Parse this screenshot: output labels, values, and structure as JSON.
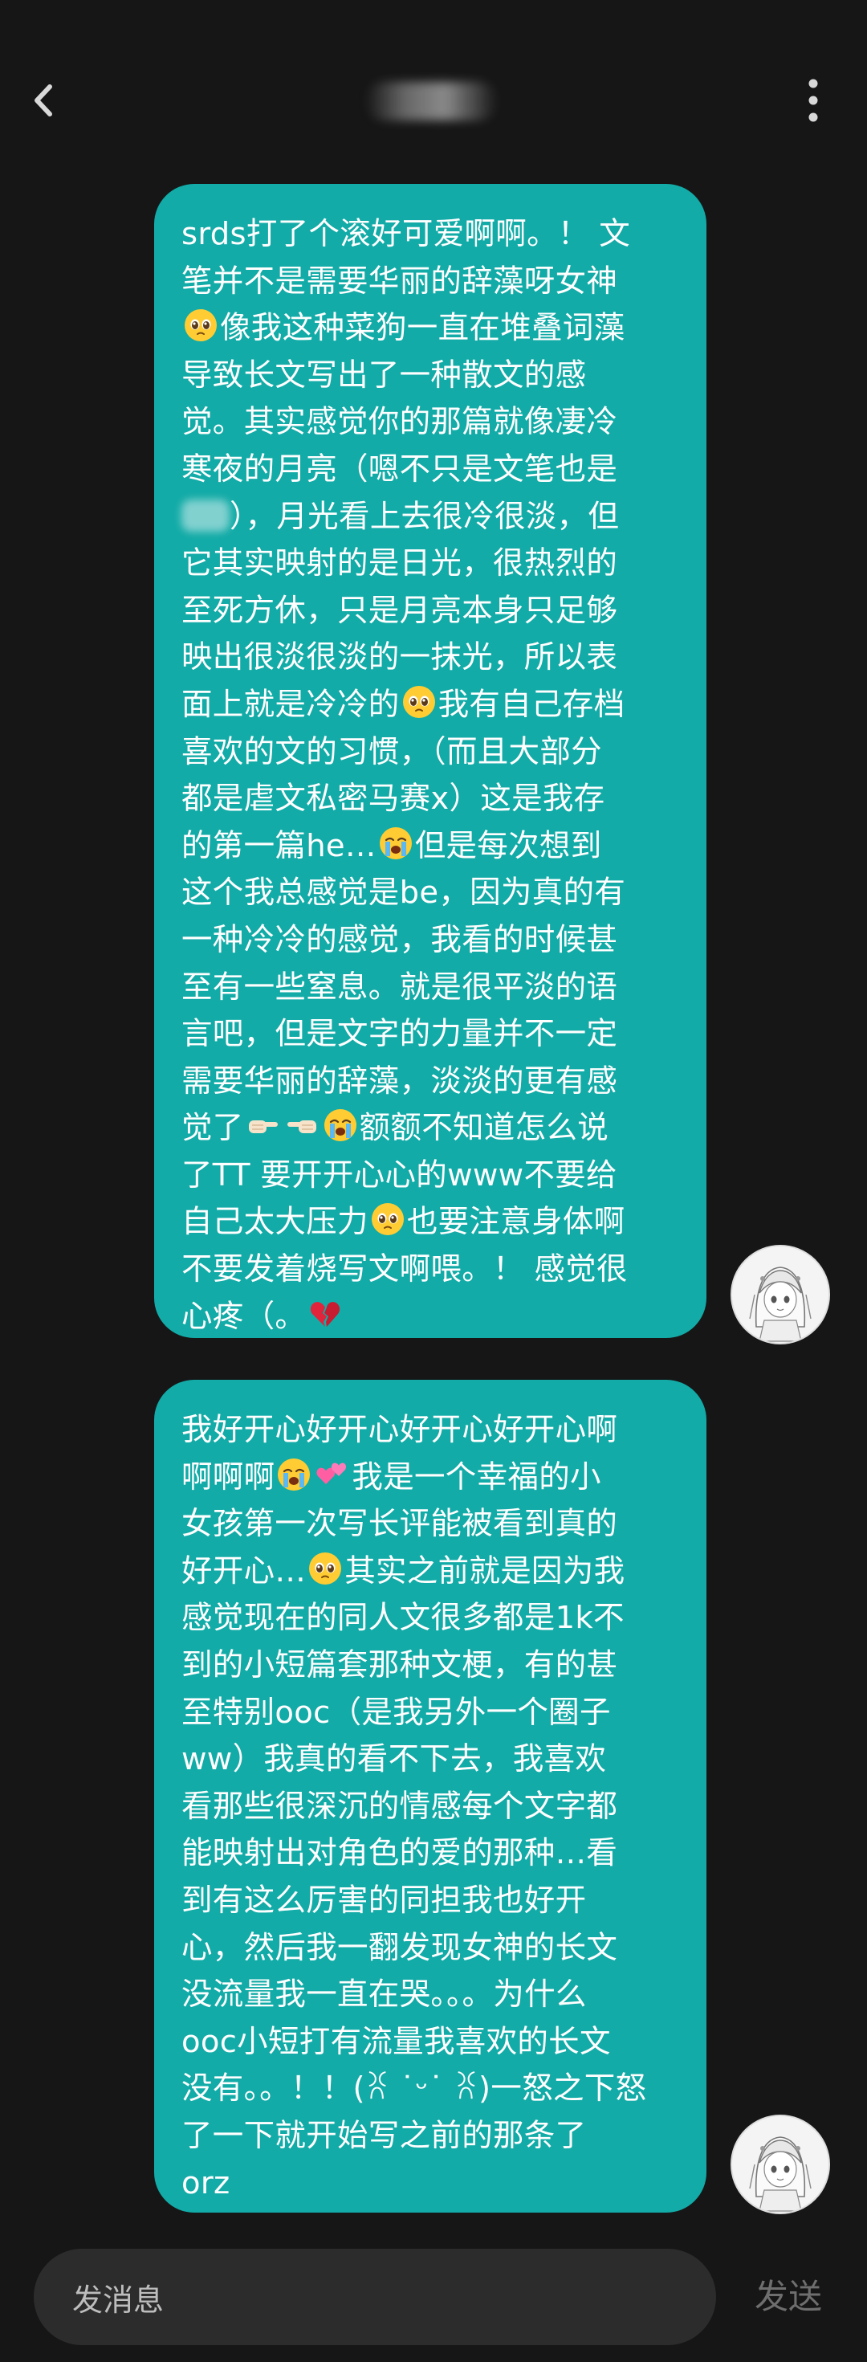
{
  "header": {
    "title": "",
    "back_icon": "chevron-left-icon",
    "more_icon": "more-vertical-icon"
  },
  "messages": [
    {
      "lines": [
        [
          {
            "t": "srds打了个滚好可爱啊啊。！  文"
          }
        ],
        [
          {
            "t": "笔并不是需要华丽的辞藻呀女神"
          }
        ],
        [
          {
            "e": "pleading-face-emoji"
          },
          {
            "t": "像我这种菜狗一直在堆叠词藻"
          }
        ],
        [
          {
            "t": "导致长文写出了一种散文的感"
          }
        ],
        [
          {
            "t": "觉。其实感觉你的那篇就像凄冷"
          }
        ],
        [
          {
            "t": "寒夜的月亮（嗯不只是文笔也是"
          }
        ],
        [
          {
            "b": "blurred-word"
          },
          {
            "t": "），月光看上去很冷很淡，但"
          }
        ],
        [
          {
            "t": "它其实映射的是日光，很热烈的"
          }
        ],
        [
          {
            "t": "至死方休，只是月亮本身只足够"
          }
        ],
        [
          {
            "t": "映出很淡很淡的一抹光，所以表"
          }
        ],
        [
          {
            "t": "面上就是冷冷的"
          },
          {
            "e": "pleading-face-emoji"
          },
          {
            "t": "我有自己存档"
          }
        ],
        [
          {
            "t": "喜欢的文的习惯，（而且大部分"
          }
        ],
        [
          {
            "t": "都是虐文私密马赛x）这是我存"
          }
        ],
        [
          {
            "t": "的第一篇he…"
          },
          {
            "e": "crying-face-emoji"
          },
          {
            "t": "但是每次想到"
          }
        ],
        [
          {
            "t": "这个我总感觉是be，因为真的有"
          }
        ],
        [
          {
            "t": "一种冷冷的感觉，我看的时候甚"
          }
        ],
        [
          {
            "t": "至有一些窒息。就是很平淡的语"
          }
        ],
        [
          {
            "t": "言吧，但是文字的力量并不一定"
          }
        ],
        [
          {
            "t": "需要华丽的辞藻，淡淡的更有感"
          }
        ],
        [
          {
            "t": "觉了"
          },
          {
            "e": "pointing-right-emoji"
          },
          {
            "e": "pointing-left-emoji"
          },
          {
            "e": "crying-face-emoji"
          },
          {
            "t": "额额不知道怎么说"
          }
        ],
        [
          {
            "t": "了TT 要开开心心的www不要给"
          }
        ],
        [
          {
            "t": "自己太大压力"
          },
          {
            "e": "pleading-face-emoji"
          },
          {
            "t": "也要注意身体啊"
          }
        ],
        [
          {
            "t": "不要发着烧写文啊喂。！ 感觉很"
          }
        ],
        [
          {
            "t": "心疼（。"
          },
          {
            "e": "broken-heart-emoji"
          }
        ]
      ]
    },
    {
      "lines": [
        [
          {
            "t": "我好开心好开心好开心好开心啊"
          }
        ],
        [
          {
            "t": "啊啊啊"
          },
          {
            "e": "crying-face-emoji"
          },
          {
            "e": "two-hearts-emoji"
          },
          {
            "t": "我是一个幸福的小"
          }
        ],
        [
          {
            "t": "女孩第一次写长评能被看到真的"
          }
        ],
        [
          {
            "t": "好开心…"
          },
          {
            "e": "pleading-face-emoji"
          },
          {
            "t": "其实之前就是因为我"
          }
        ],
        [
          {
            "t": "感觉现在的同人文很多都是1k不"
          }
        ],
        [
          {
            "t": "到的小短篇套那种文梗，有的甚"
          }
        ],
        [
          {
            "t": "至特别ooc（是我另外一个圈子"
          }
        ],
        [
          {
            "t": "ww）我真的看不下去，我喜欢"
          }
        ],
        [
          {
            "t": "看那些很深沉的情感每个文字都"
          }
        ],
        [
          {
            "t": "能映射出对角色的爱的那种…看"
          }
        ],
        [
          {
            "t": "到有这么厉害的同担我也好开"
          }
        ],
        [
          {
            "t": "心，然后我一翻发现女神的长文"
          }
        ],
        [
          {
            "t": "没流量我一直在哭。。。为什么"
          }
        ],
        [
          {
            "t": "ooc小短打有流量我喜欢的长文"
          }
        ],
        [
          {
            "t": "没有。。！！(ꐦ ˙ᵕ˙ ꐦ)一怒之下怒"
          }
        ],
        [
          {
            "t": "了一下就开始写之前的那条了"
          }
        ],
        [
          {
            "t": "orz"
          }
        ]
      ]
    }
  ],
  "composer": {
    "placeholder": "发消息",
    "send_label": "发送"
  },
  "colors": {
    "background": "#161616",
    "bubble": "#12aba7",
    "input": "#2c2c2c",
    "send_disabled": "#6e6e6e"
  }
}
